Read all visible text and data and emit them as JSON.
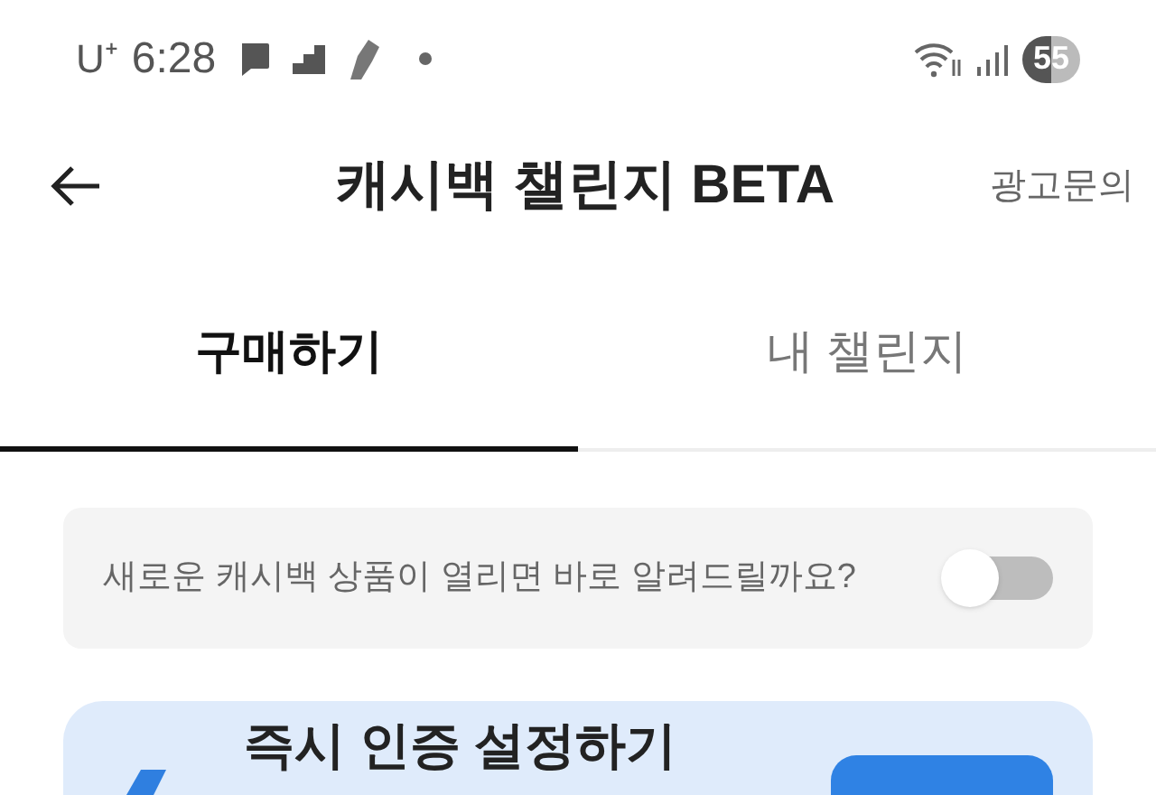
{
  "status_bar": {
    "carrier": "U⁺",
    "time": "6:28",
    "battery": "55"
  },
  "header": {
    "title": "캐시백 챌린지 BETA",
    "action": "광고문의"
  },
  "tabs": [
    {
      "label": "구매하기",
      "selected": true
    },
    {
      "label": "내 챌린지",
      "selected": false
    }
  ],
  "notify": {
    "text": "새로운 캐시백 상품이 열리면 바로 알려드릴까요?",
    "on": false
  },
  "promo": {
    "title": "즉시 인증 설정하기"
  }
}
